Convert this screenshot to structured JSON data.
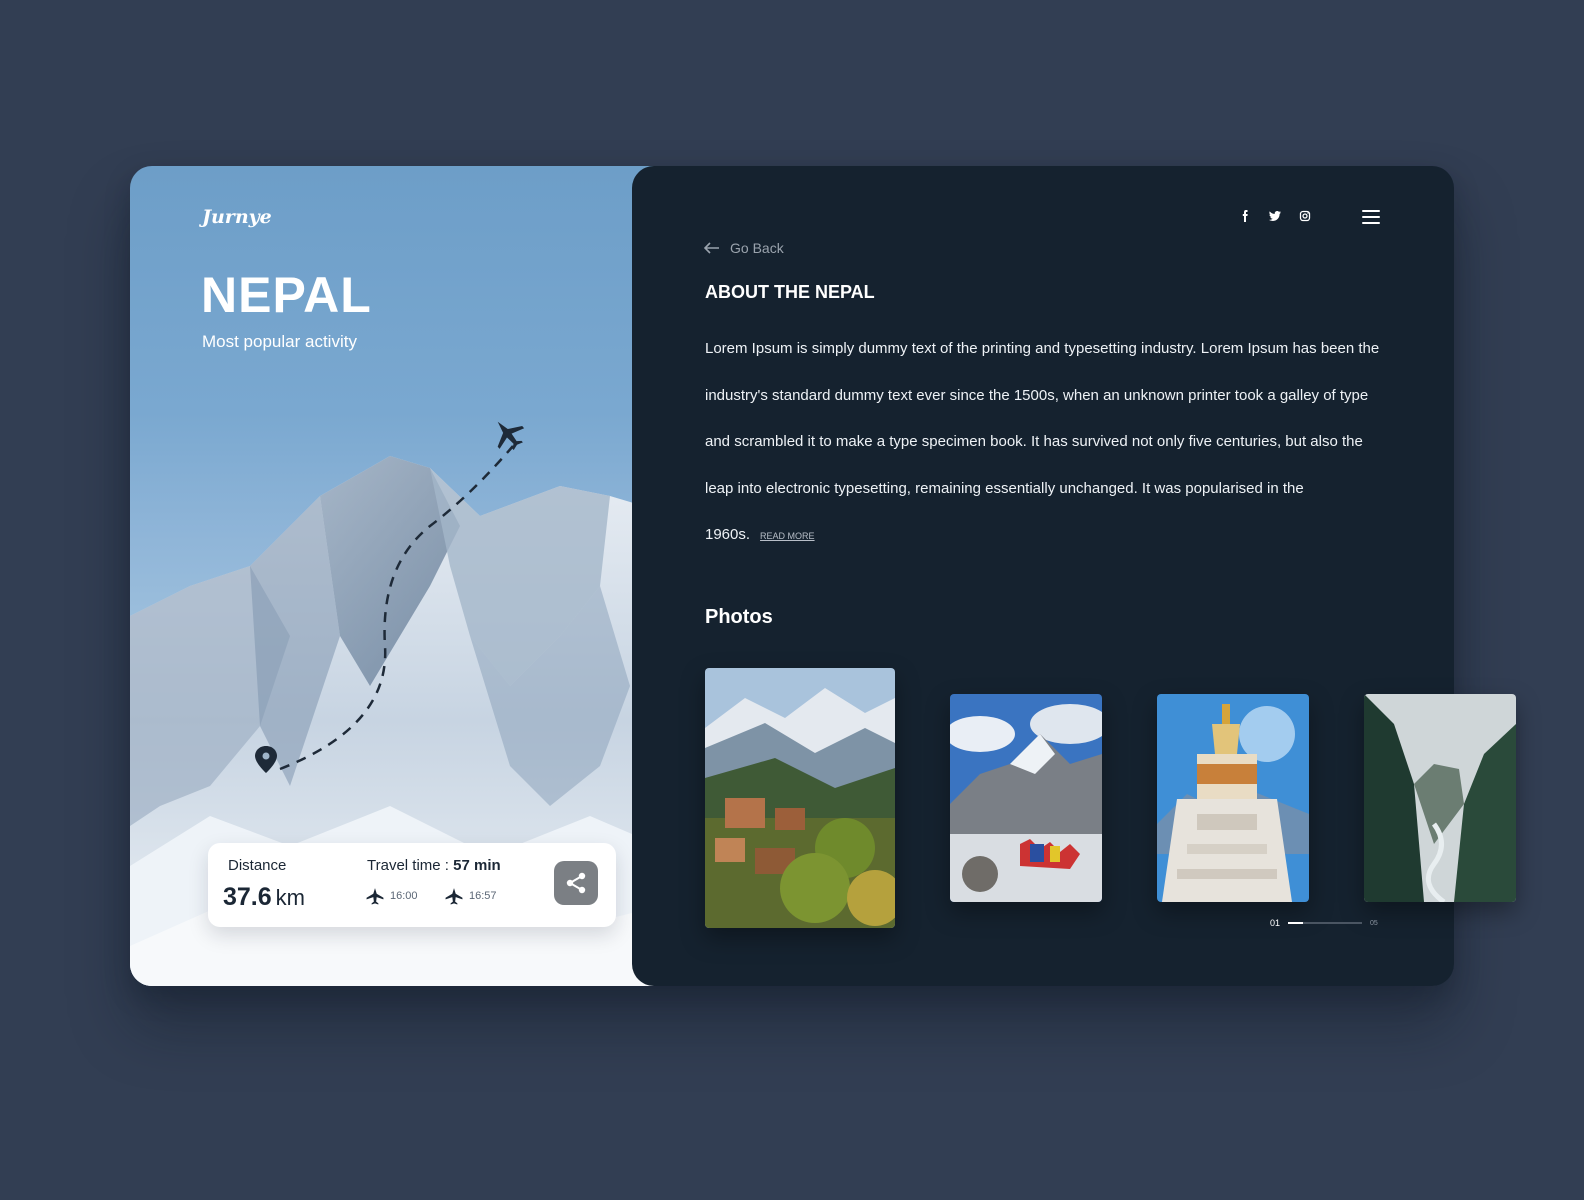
{
  "brand": {
    "logo": "Jurnye"
  },
  "hero": {
    "title": "NEPAL",
    "subtitle": "Most popular activity"
  },
  "trip": {
    "distance_label": "Distance",
    "distance_value": "37.6",
    "distance_unit": "km",
    "travel_time_label": "Travel time :",
    "travel_time_value": "57 min",
    "departure_time": "16:00",
    "arrival_time": "16:57"
  },
  "nav": {
    "go_back": "Go Back",
    "social_icons": [
      "facebook-icon",
      "twitter-icon",
      "instagram-icon"
    ]
  },
  "about": {
    "heading": "ABOUT THE NEPAL",
    "body": "Lorem Ipsum is simply dummy text of the printing and typesetting industry. Lorem Ipsum has been the industry's standard dummy text ever since the 1500s, when an unknown printer took a galley of type and scrambled it to make a type specimen book. It has survived not only five centuries, but also the leap into electronic typesetting, remaining essentially unchanged. It was popularised in the 1960s.",
    "read_more": "READ MORE"
  },
  "photos": {
    "heading": "Photos",
    "items": [
      "village-mountain-photo",
      "snowy-peaks-prayer-flags-photo",
      "stupa-photo",
      "river-valley-photo"
    ]
  },
  "pager": {
    "current": "01",
    "total": "05",
    "progress": 0.2
  },
  "colors": {
    "page_bg": "#323e53",
    "panel_bg": "#15222f",
    "accent_white": "#ffffff"
  }
}
